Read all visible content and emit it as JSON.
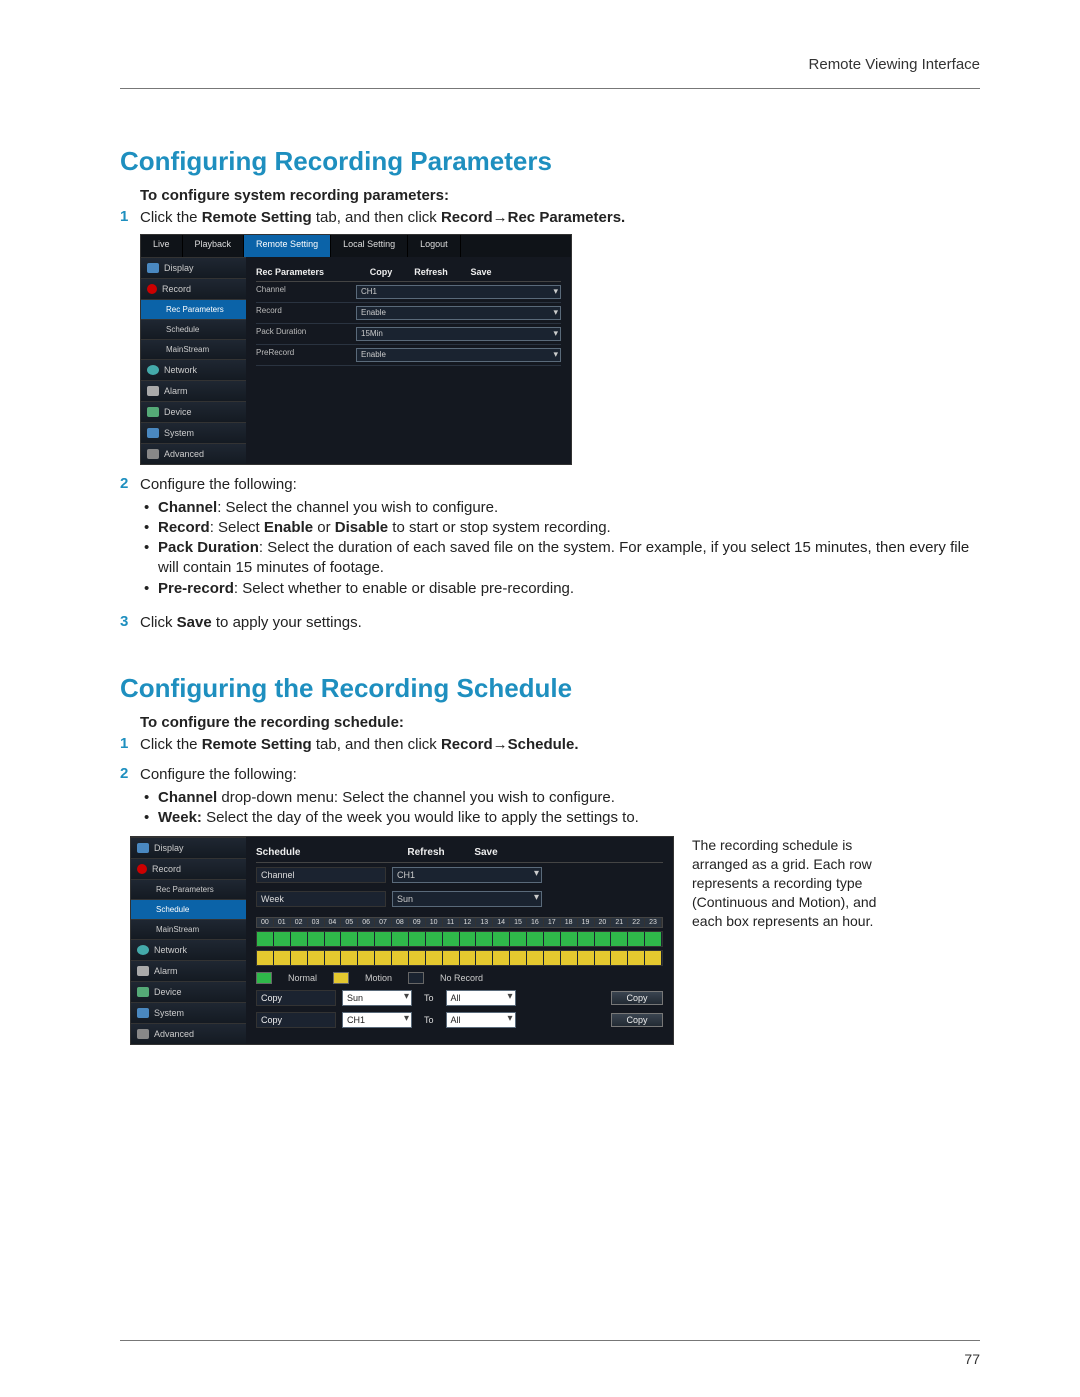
{
  "header": {
    "label": "Remote Viewing Interface"
  },
  "page_number": "77",
  "s1_title": "Configuring Recording Parameters",
  "s1_sub": "To configure system recording parameters:",
  "s1_step1_a": "Click the ",
  "s1_step1_b": "Remote Setting",
  "s1_step1_c": " tab, and then click ",
  "s1_step1_d": "Record→Rec Parameters.",
  "s1_step2": "Configure the following:",
  "s1_b1_a": "Channel",
  "s1_b1_b": ": Select the channel you wish to configure.",
  "s1_b2_a": "Record",
  "s1_b2_b": ": Select ",
  "s1_b2_c": "Enable",
  "s1_b2_d": " or ",
  "s1_b2_e": "Disable",
  "s1_b2_f": " to start or stop system recording.",
  "s1_b3_a": "Pack Duration",
  "s1_b3_b": ": Select the duration of each saved file on the system. For example, if you select 15 minutes, then every file will contain 15 minutes of footage.",
  "s1_b4_a": "Pre-record",
  "s1_b4_b": ": Select whether to enable or disable pre-recording.",
  "s1_step3_a": "Click ",
  "s1_step3_b": "Save",
  "s1_step3_c": " to apply your settings.",
  "s2_title": "Configuring the Recording Schedule",
  "s2_sub": "To configure the recording schedule:",
  "s2_step1_a": "Click the ",
  "s2_step1_b": "Remote Setting",
  "s2_step1_c": " tab, and then click ",
  "s2_step1_d": "Record→Schedule.",
  "s2_step2": "Configure the following:",
  "s2_b1_a": "Channel",
  "s2_b1_b": " drop-down menu: Select the channel you wish to configure.",
  "s2_b2_a": "Week:",
  "s2_b2_b": " Select the day of the week you would like to apply the settings to.",
  "shot1": {
    "tabs": {
      "live": "Live",
      "playback": "Playback",
      "remote": "Remote Setting",
      "local": "Local Setting",
      "logout": "Logout"
    },
    "side": {
      "display": "Display",
      "record": "Record",
      "recparams": "Rec Parameters",
      "schedule": "Schedule",
      "mainstream": "MainStream",
      "network": "Network",
      "alarm": "Alarm",
      "device": "Device",
      "system": "System",
      "advanced": "Advanced"
    },
    "pane_title": "Rec Parameters",
    "btn_copy": "Copy",
    "btn_refresh": "Refresh",
    "btn_save": "Save",
    "rows": {
      "channel_l": "Channel",
      "channel_v": "CH1",
      "record_l": "Record",
      "record_v": "Enable",
      "pack_l": "Pack Duration",
      "pack_v": "15Min",
      "pre_l": "PreRecord",
      "pre_v": "Enable"
    }
  },
  "shot2": {
    "side": {
      "display": "Display",
      "record": "Record",
      "recparams": "Rec Parameters",
      "schedule": "Schedule",
      "mainstream": "MainStream",
      "network": "Network",
      "alarm": "Alarm",
      "device": "Device",
      "system": "System",
      "advanced": "Advanced"
    },
    "pane_title": "Schedule",
    "btn_refresh": "Refresh",
    "btn_save": "Save",
    "row_channel_l": "Channel",
    "row_channel_v": "CH1",
    "row_week_l": "Week",
    "row_week_v": "Sun",
    "hours": [
      "00",
      "01",
      "02",
      "03",
      "04",
      "05",
      "06",
      "07",
      "08",
      "09",
      "10",
      "11",
      "12",
      "13",
      "14",
      "15",
      "16",
      "17",
      "18",
      "19",
      "20",
      "21",
      "22",
      "23"
    ],
    "legend": {
      "normal": "Normal",
      "motion": "Motion",
      "norec": "No Record"
    },
    "copy_l": "Copy",
    "to": "To",
    "copy1_from": "Sun",
    "copy1_to": "All",
    "copy2_from": "CH1",
    "copy2_to": "All",
    "copy_btn": "Copy"
  },
  "caption": "The recording schedule is arranged as a grid. Each row represents a recording type (Continuous and Motion), and each box represents an hour."
}
